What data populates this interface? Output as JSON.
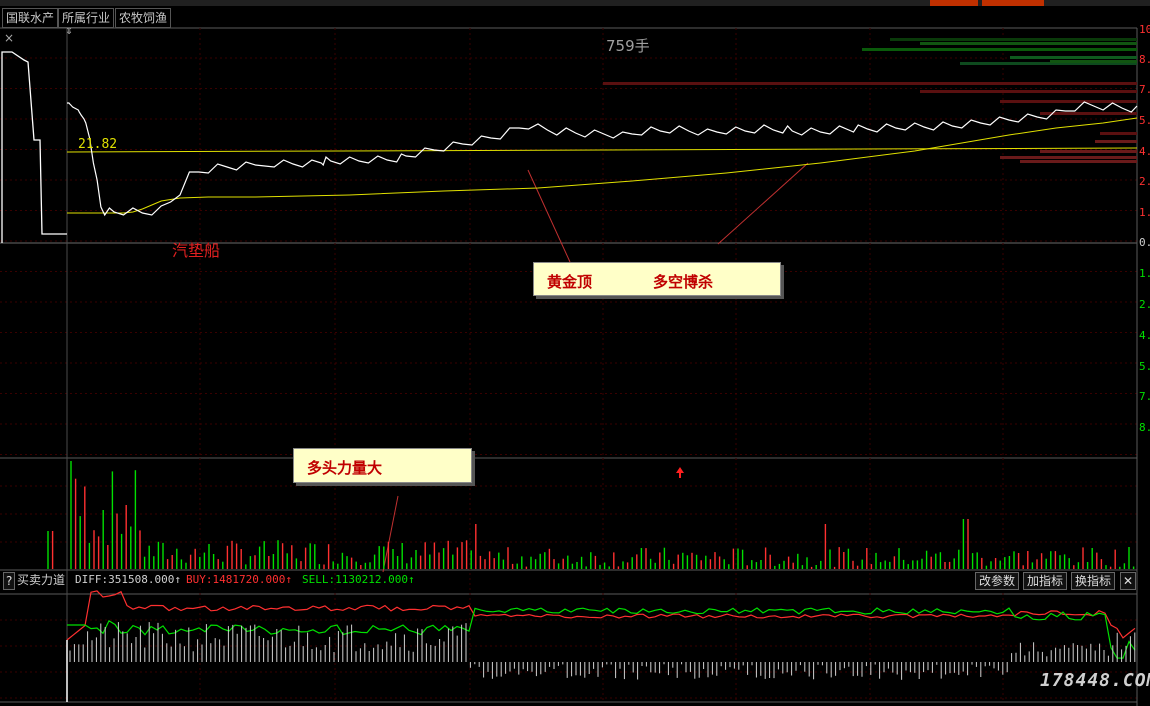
{
  "tabs": {
    "stock": "国联水产",
    "industry": "所属行业",
    "sector": "农牧饲渔"
  },
  "price_panel": {
    "ref_price": "21.82",
    "volume_label": "759手",
    "boat_label": "汽垫船"
  },
  "notes": {
    "gold_top": "黄金顶",
    "bull_bear": "多空博杀",
    "bull_power": "多头力量大"
  },
  "indicator": {
    "help": "?",
    "name": "买卖力道",
    "diff": "DIFF:351508.000↑",
    "buy": "BUY:1481720.000↑",
    "sell": "SELL:1130212.000↑",
    "btn_params": "改参数",
    "btn_add": "加指标",
    "btn_switch": "换指标",
    "btn_close": "✕"
  },
  "watermark": "178448.COM",
  "right_axis_labels": [
    "10",
    "8.",
    "7.",
    "5.",
    "4.",
    "2.",
    "1.",
    "0.",
    "1.",
    "2.",
    "4.",
    "5.",
    "7.",
    "8."
  ],
  "colors": {
    "bg": "#000000",
    "price": "#ffffff",
    "avg": "#e0e000",
    "up": "#ff3030",
    "down": "#00e000"
  },
  "chart_data": {
    "type": "line",
    "price_line": {
      "x": [
        0,
        1,
        2,
        3,
        4,
        5,
        6,
        8,
        10,
        12,
        13,
        15,
        18,
        20,
        24,
        28,
        32,
        36,
        40,
        45,
        50,
        60,
        70,
        80,
        90,
        100,
        110,
        120,
        130,
        140,
        150,
        160,
        170,
        180,
        190,
        200,
        220,
        230,
        240,
        250,
        260,
        270,
        272,
        275,
        280,
        290,
        300,
        310,
        320,
        330,
        340,
        350,
        355,
        360,
        370,
        380,
        390,
        400,
        410,
        420,
        430,
        440,
        450,
        460,
        470,
        480,
        490,
        500,
        510,
        520,
        530,
        540,
        550,
        560,
        570,
        580,
        590,
        600,
        610,
        620,
        630,
        640,
        650,
        660,
        670,
        680,
        690,
        700,
        710,
        720,
        730,
        740,
        750,
        760,
        765,
        770,
        780,
        790,
        800,
        810,
        820,
        830,
        835,
        840,
        850,
        860,
        870,
        880,
        890,
        900,
        910,
        920,
        930,
        940,
        950,
        960,
        970,
        980,
        990,
        1000,
        1010,
        1020,
        1030,
        1040,
        1050,
        1060,
        1070,
        1080,
        1090,
        1100,
        1110,
        1120,
        1130,
        1136
      ],
      "y": [
        140,
        140,
        140,
        139,
        138,
        137,
        136,
        135,
        134,
        133,
        131,
        128,
        124,
        120,
        105,
        80,
        60,
        37,
        32,
        32,
        32,
        32,
        32,
        31,
        32,
        34,
        42,
        52,
        68,
        72,
        74,
        76,
        77,
        77,
        78,
        79,
        80,
        80,
        80,
        80,
        80,
        81,
        82,
        83,
        83,
        83,
        83,
        83,
        84,
        84,
        84,
        85,
        86,
        88,
        90,
        92,
        94,
        96,
        98,
        100,
        102,
        104,
        106,
        108,
        112,
        116,
        118,
        116,
        114,
        112,
        112,
        111,
        110,
        110,
        110,
        109,
        108,
        110,
        112,
        113,
        113,
        114,
        114,
        113,
        112,
        111,
        112,
        113,
        113,
        113,
        114,
        115,
        114,
        114,
        114,
        113,
        112,
        112,
        112,
        113,
        114,
        114,
        115,
        115,
        115,
        115,
        116,
        116,
        117,
        117,
        117,
        117,
        118,
        118,
        119,
        120,
        121,
        122,
        123,
        124,
        125,
        126,
        127,
        128,
        130,
        133,
        136,
        138,
        138,
        137,
        137,
        136,
        135,
        134
      ]
    },
    "avg_line": {
      "x": [
        0,
        60,
        70,
        80,
        90,
        100,
        120,
        150,
        200,
        300,
        400,
        500,
        600,
        700,
        800,
        900,
        1000,
        1050,
        1100,
        1136
      ],
      "y": [
        30,
        30,
        31,
        34,
        38,
        42,
        45,
        46,
        46,
        48,
        52,
        55,
        62,
        70,
        80,
        92,
        108,
        115,
        120,
        125
      ]
    }
  }
}
